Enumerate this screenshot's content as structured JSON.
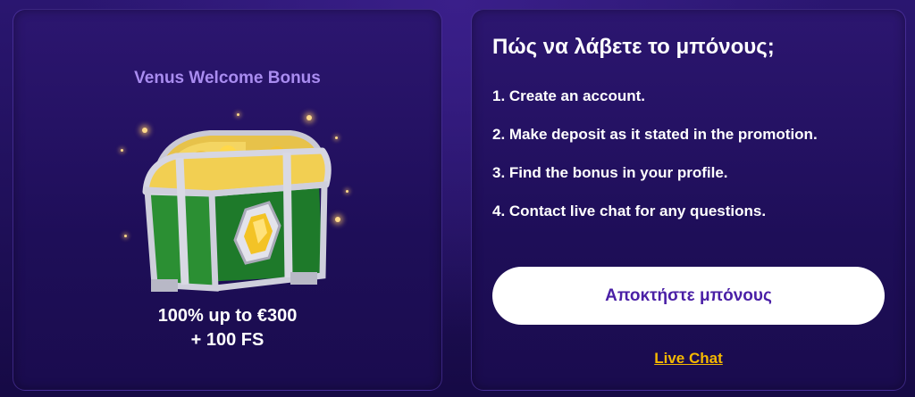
{
  "bonus": {
    "title": "Venus Welcome Bonus",
    "offer_line1": "100% up to €300",
    "offer_line2": "+ 100 FS"
  },
  "how_to": {
    "title": "Πώς να λάβετε το μπόνους;",
    "steps": [
      "1. Create an account.",
      "2. Make deposit as it stated in the promotion.",
      "3. Find the bonus in your profile.",
      "4. Contact live chat for any questions."
    ],
    "cta_label": "Αποκτήστε μπόνους",
    "live_chat_label": "Live Chat"
  },
  "colors": {
    "background": "#1c0f52",
    "accent_purple": "#4a1fa6",
    "link_yellow": "#f5b800",
    "bonus_title": "#a98cf0"
  },
  "icons": {
    "chest": "treasure-chest-icon"
  }
}
